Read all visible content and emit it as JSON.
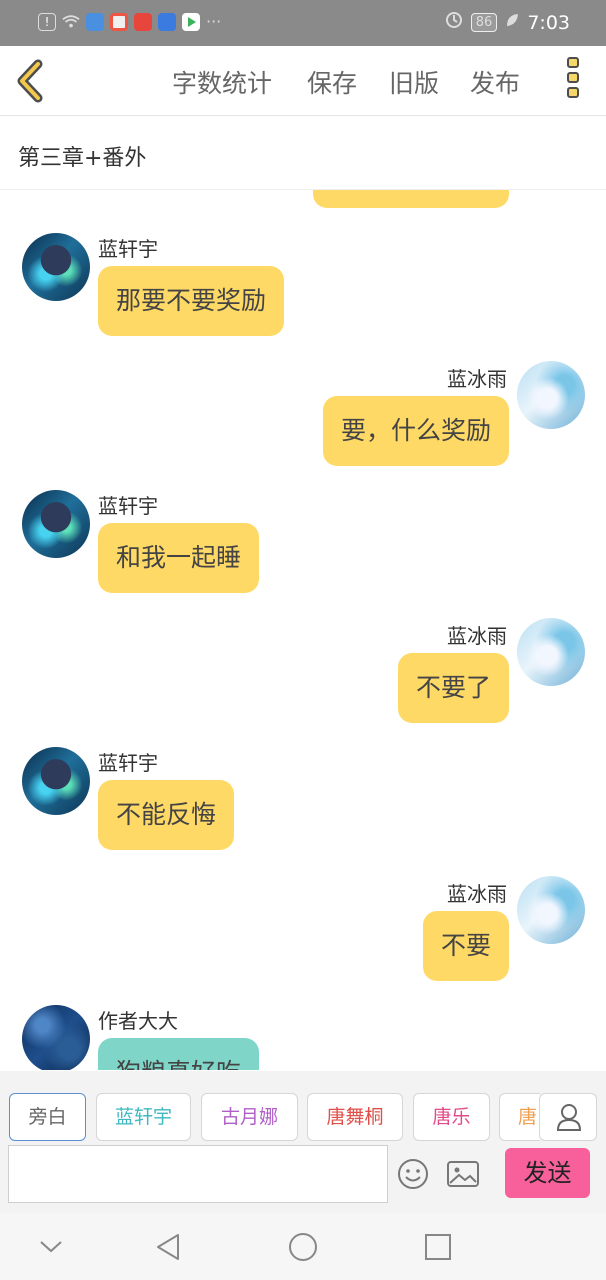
{
  "status_bar": {
    "time": "7:03",
    "battery": "86"
  },
  "header": {
    "nav_items": [
      "字数统计",
      "保存",
      "旧版",
      "发布"
    ]
  },
  "chapter": {
    "title": "第三章+番外"
  },
  "messages": [
    {
      "side": "left",
      "name": "蓝轩宇",
      "text": "那要不要奖励",
      "avatar": "boy-avatar"
    },
    {
      "side": "right",
      "name": "蓝冰雨",
      "text": "要，什么奖励",
      "avatar": "girl-avatar"
    },
    {
      "side": "left",
      "name": "蓝轩宇",
      "text": "和我一起睡",
      "avatar": "boy-avatar"
    },
    {
      "side": "right",
      "name": "蓝冰雨",
      "text": "不要了",
      "avatar": "girl-avatar"
    },
    {
      "side": "left",
      "name": "蓝轩宇",
      "text": "不能反悔",
      "avatar": "boy-avatar"
    },
    {
      "side": "right",
      "name": "蓝冰雨",
      "text": "不要",
      "avatar": "girl-avatar"
    },
    {
      "side": "left",
      "name": "作者大大",
      "text": "狗粮真好吃",
      "avatar": "author-avatar"
    }
  ],
  "character_tabs": [
    {
      "label": "旁白",
      "color": "#666666",
      "active": true
    },
    {
      "label": "蓝轩宇",
      "color": "#3fb8c2"
    },
    {
      "label": "古月娜",
      "color": "#b05fc8"
    },
    {
      "label": "唐舞桐",
      "color": "#e0504a"
    },
    {
      "label": "唐乐",
      "color": "#e04a8a"
    },
    {
      "label": "唐",
      "color": "#f0a050"
    }
  ],
  "composer": {
    "input_value": "",
    "send_label": "发送"
  },
  "colors": {
    "bubble": "#ffd966",
    "author_bubble": "#7fd6c8",
    "send": "#f7609a",
    "back_arrow": "#f2c94c"
  }
}
